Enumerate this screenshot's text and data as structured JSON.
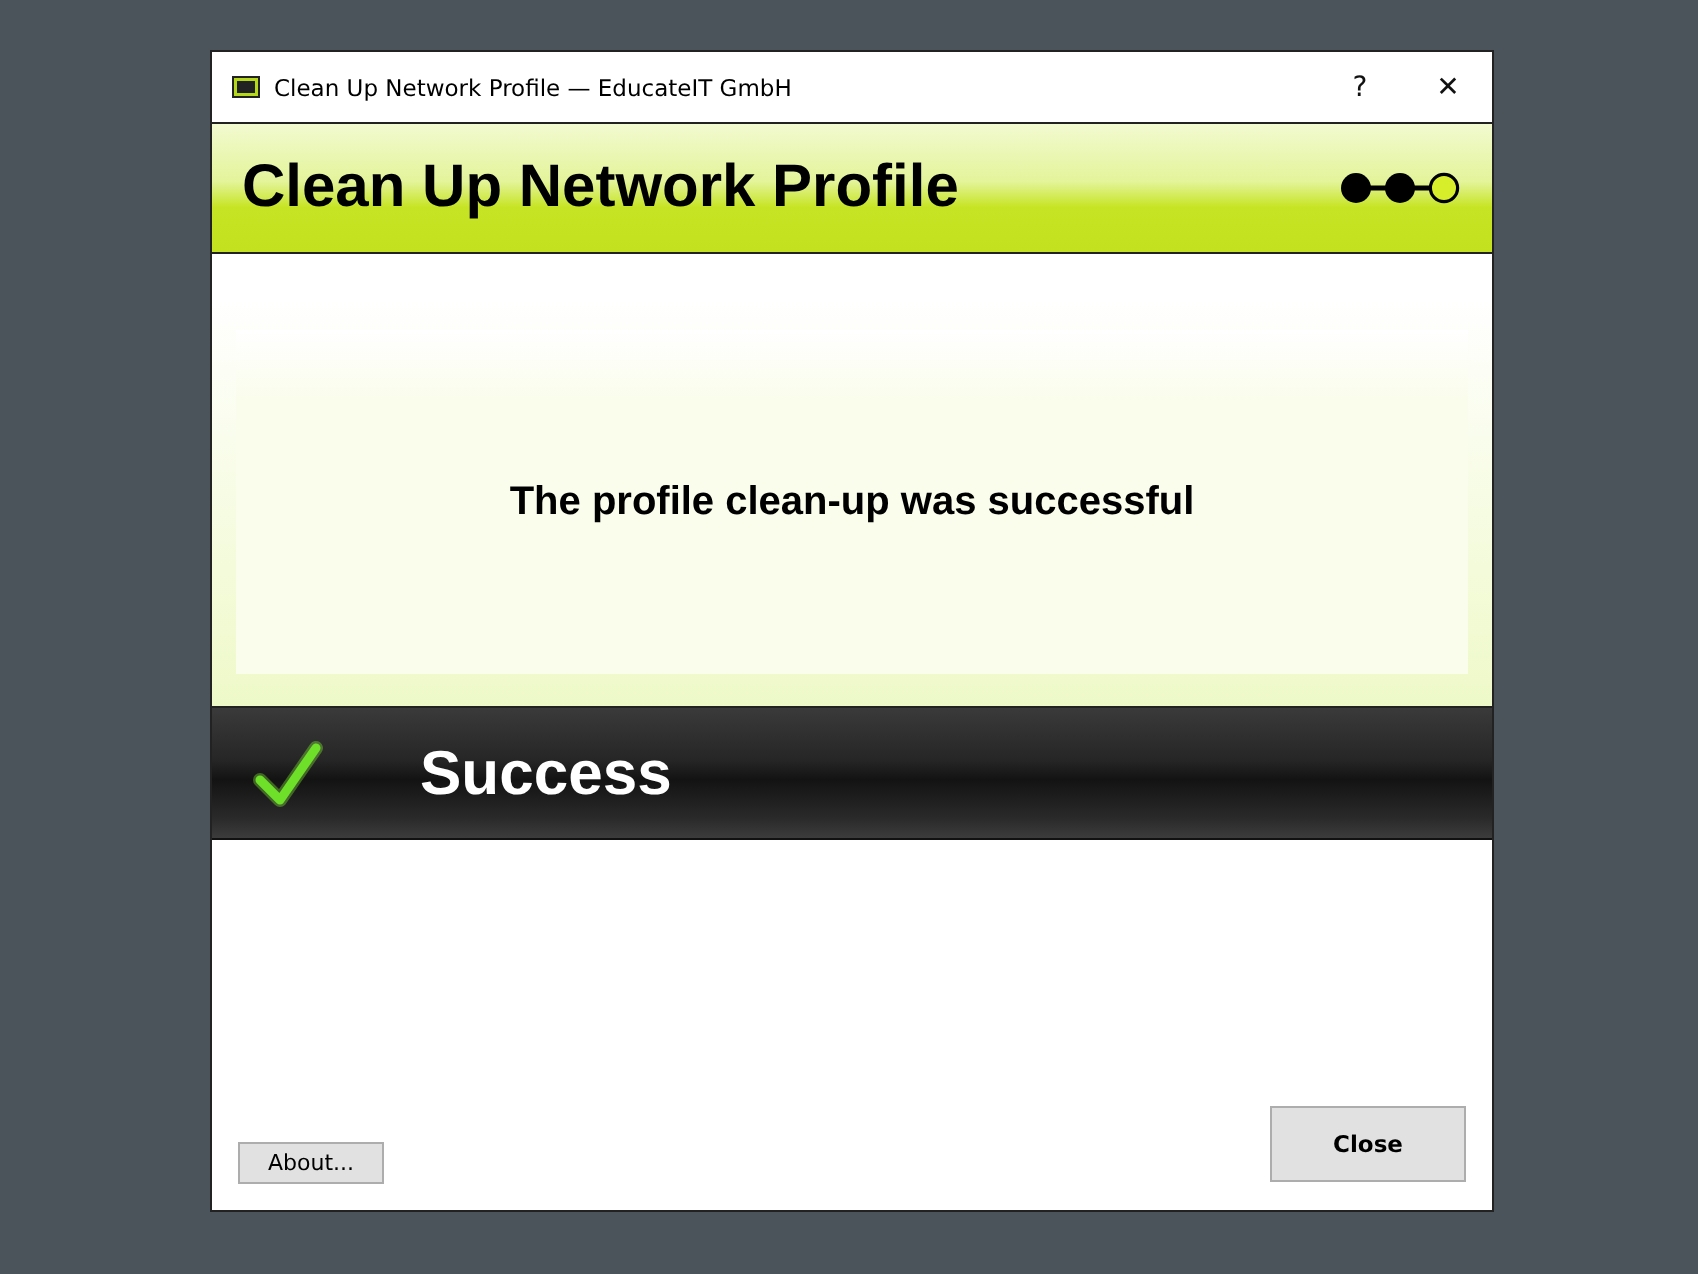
{
  "window": {
    "title": "Clean Up Network Profile — EducateIT GmbH",
    "help_glyph": "?",
    "close_glyph": "✕"
  },
  "header": {
    "title": "Clean Up Network Profile",
    "steps": [
      {
        "completed": true
      },
      {
        "completed": true
      },
      {
        "completed": false
      }
    ]
  },
  "message": "The profile clean-up was successful",
  "status": {
    "kind": "success",
    "label": "Success"
  },
  "buttons": {
    "about": "About...",
    "close": "Close"
  }
}
